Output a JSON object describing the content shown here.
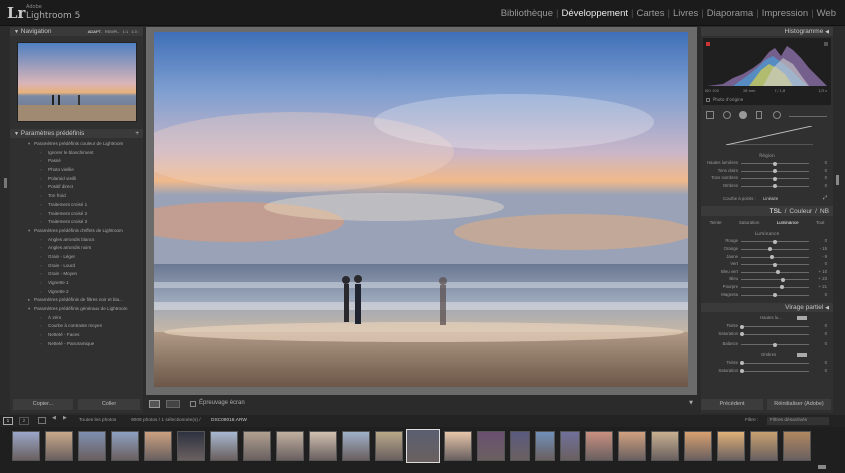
{
  "app": {
    "brand_small": "Adobe",
    "brand": "Lightroom 5",
    "logo": "Lr"
  },
  "modules": [
    {
      "label": "Bibliothèque",
      "active": false
    },
    {
      "label": "Développement",
      "active": true
    },
    {
      "label": "Cartes",
      "active": false
    },
    {
      "label": "Livres",
      "active": false
    },
    {
      "label": "Diaporama",
      "active": false
    },
    {
      "label": "Impression",
      "active": false
    },
    {
      "label": "Web",
      "active": false
    }
  ],
  "navigation": {
    "title": "Navigation",
    "zoom_options": [
      "ADAPT.",
      "REMPL.",
      "1:1",
      "1:3 :"
    ]
  },
  "presets": {
    "title": "Paramètres prédéfinis",
    "add": "+",
    "items": [
      {
        "label": "Paramètres prédéfinis couleur de Lightroom",
        "level": "folder",
        "open": true
      },
      {
        "label": "Ignorer le blanchiment",
        "level": "item"
      },
      {
        "label": "Passé",
        "level": "item"
      },
      {
        "label": "Photo vieillie",
        "level": "item"
      },
      {
        "label": "Polaroid vieilli",
        "level": "item"
      },
      {
        "label": "Positif direct",
        "level": "item"
      },
      {
        "label": "Ton froid",
        "level": "item"
      },
      {
        "label": "Traitement croisé 1",
        "level": "item"
      },
      {
        "label": "Traitement croisé 2",
        "level": "item"
      },
      {
        "label": "Traitement croisé 3",
        "level": "item"
      },
      {
        "label": "Paramètres prédéfinis d'effets de Lightroom",
        "level": "folder",
        "open": true
      },
      {
        "label": "Angles arrondis blancs",
        "level": "item"
      },
      {
        "label": "Angles arrondis noirs",
        "level": "item"
      },
      {
        "label": "Grain - Léger",
        "level": "item"
      },
      {
        "label": "Grain - Lourd",
        "level": "item"
      },
      {
        "label": "Grain - Moyen",
        "level": "item"
      },
      {
        "label": "Vignette 1",
        "level": "item"
      },
      {
        "label": "Vignette 2",
        "level": "item"
      },
      {
        "label": "Paramètres prédéfinis de filtres noir et bla...",
        "level": "folder",
        "open": false
      },
      {
        "label": "Paramètres prédéfinis généraux de Lightroom",
        "level": "folder",
        "open": true
      },
      {
        "label": "À zéro",
        "level": "item"
      },
      {
        "label": "Courbe à contraste moyen",
        "level": "item"
      },
      {
        "label": "Netteté - Faces",
        "level": "item"
      },
      {
        "label": "Netteté - Panoramique",
        "level": "item"
      }
    ]
  },
  "left_buttons": {
    "copy": "Copier...",
    "paste": "Coller"
  },
  "toolbar": {
    "proof": "Épreuvage écran"
  },
  "histogram": {
    "title": "Histogramme",
    "iso": "ISO 100",
    "focal": "28 mm",
    "aperture": "f / 1,8",
    "exposure": "1/3 s",
    "original": "Photo d'origine"
  },
  "tone_curve": {
    "region": "Région",
    "rows": [
      {
        "label": "Hautes lumières",
        "value": "0"
      },
      {
        "label": "Tons clairs",
        "value": "0"
      },
      {
        "label": "Tons sombres",
        "value": "0"
      },
      {
        "label": "Ombres",
        "value": "0"
      }
    ],
    "point_curve_label": "Courbe à points :",
    "point_curve_value": "Linéaire"
  },
  "hsl": {
    "tabs_top": [
      "TSL",
      "/",
      "Couleur",
      "/",
      "NB"
    ],
    "tabs": [
      "Teinte",
      "Saturation",
      "Luminance",
      "Tout"
    ],
    "active_tab": "Luminance",
    "section": "Luminance",
    "rows": [
      {
        "label": "Rouge",
        "value": "0",
        "level": 0.5
      },
      {
        "label": "Orange",
        "value": "- 15",
        "level": 0.425
      },
      {
        "label": "Jaune",
        "value": "- 9",
        "level": 0.455
      },
      {
        "label": "Vert",
        "value": "0",
        "level": 0.5
      },
      {
        "label": "Bleu vert",
        "value": "+ 10",
        "level": 0.55
      },
      {
        "label": "Bleu",
        "value": "+ 23",
        "level": 0.615
      },
      {
        "label": "Pourpre",
        "value": "+ 21",
        "level": 0.605
      },
      {
        "label": "Magenta",
        "value": "0",
        "level": 0.5
      }
    ]
  },
  "split_toning": {
    "title": "Virage partiel",
    "highlights": "Hautes lu...",
    "highlight_rows": [
      {
        "label": "Teinte",
        "value": "0"
      },
      {
        "label": "Saturation",
        "value": "0"
      }
    ],
    "balance": {
      "label": "Balance",
      "value": "0"
    },
    "shadows": "Ombres",
    "shadow_rows": [
      {
        "label": "Teinte",
        "value": "0"
      },
      {
        "label": "Saturation",
        "value": "0"
      }
    ]
  },
  "right_buttons": {
    "previous": "Précédent",
    "reset": "Réinitialiser (Adobe)"
  },
  "filmbar": {
    "pages": [
      "1",
      "2"
    ],
    "source": "Toutes les photos",
    "count": "9008 photos / 1 sélectionnée(s) /",
    "file": "DSC09018.ARW",
    "filter_label": "Filtre :",
    "filter_value": "Filtres désactivés"
  },
  "colors": {
    "accent": "#e8e8e8",
    "bg": "#2b2b2b",
    "panel": "#303030",
    "header": "#3a3a3a"
  }
}
